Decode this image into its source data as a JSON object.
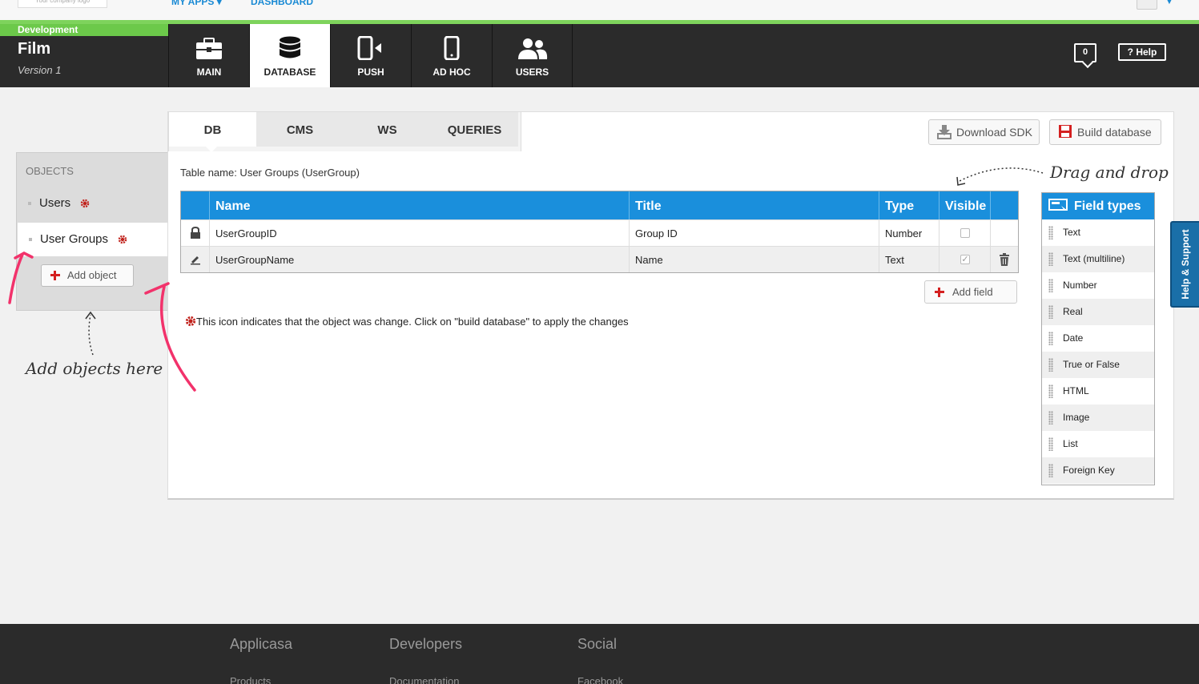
{
  "topbar": {
    "logo_text": "Your company logo",
    "my_apps": "MY APPS",
    "dashboard": "DASHBOARD"
  },
  "header": {
    "environment": "Development",
    "app_name": "Film",
    "version": "Version 1",
    "nav": [
      {
        "label": "MAIN",
        "icon": "briefcase-icon"
      },
      {
        "label": "DATABASE",
        "icon": "database-icon",
        "active": true
      },
      {
        "label": "PUSH",
        "icon": "push-phone-icon"
      },
      {
        "label": "AD HOC",
        "icon": "phone-icon"
      },
      {
        "label": "USERS",
        "icon": "users-icon"
      }
    ],
    "notifications": "0",
    "help": "? Help"
  },
  "tabs": [
    "DB",
    "CMS",
    "WS",
    "QUERIES"
  ],
  "toolbar": {
    "download_sdk": "Download SDK",
    "build_database": "Build database"
  },
  "objects": {
    "title": "OBJECTS",
    "items": [
      "Users",
      "User Groups"
    ],
    "add_object": "Add object"
  },
  "table": {
    "table_name": "Table name: User Groups (UserGroup)",
    "headers": [
      "Name",
      "Title",
      "Type",
      "Visible"
    ],
    "rows": [
      {
        "name": "UserGroupID",
        "title": "Group ID",
        "type": "Number",
        "visible": false,
        "icon": "lock-icon"
      },
      {
        "name": "UserGroupName",
        "title": "Name",
        "type": "Text",
        "visible": true,
        "icon": "pencil-icon"
      }
    ],
    "add_field": "Add field"
  },
  "info_text": "This icon indicates that the object was change. Click on \"build database\" to apply the changes",
  "field_types": {
    "title": "Field types",
    "items": [
      "Text",
      "Text (multiline)",
      "Number",
      "Real",
      "Date",
      "True or False",
      "HTML",
      "Image",
      "List",
      "Foreign Key"
    ]
  },
  "annotations": {
    "drag_and_drop": "Drag and drop",
    "add_objects_here": "Add objects here"
  },
  "help_support": "Help & Support",
  "footer": {
    "columns": [
      {
        "title": "Applicasa",
        "link": "Products"
      },
      {
        "title": "Developers",
        "link": "Documentation"
      },
      {
        "title": "Social",
        "link": "Facebook"
      }
    ]
  },
  "colors": {
    "accent_blue": "#1a8fdc",
    "green": "#6cc94a",
    "dark": "#2b2b2b",
    "red": "#d42020"
  }
}
